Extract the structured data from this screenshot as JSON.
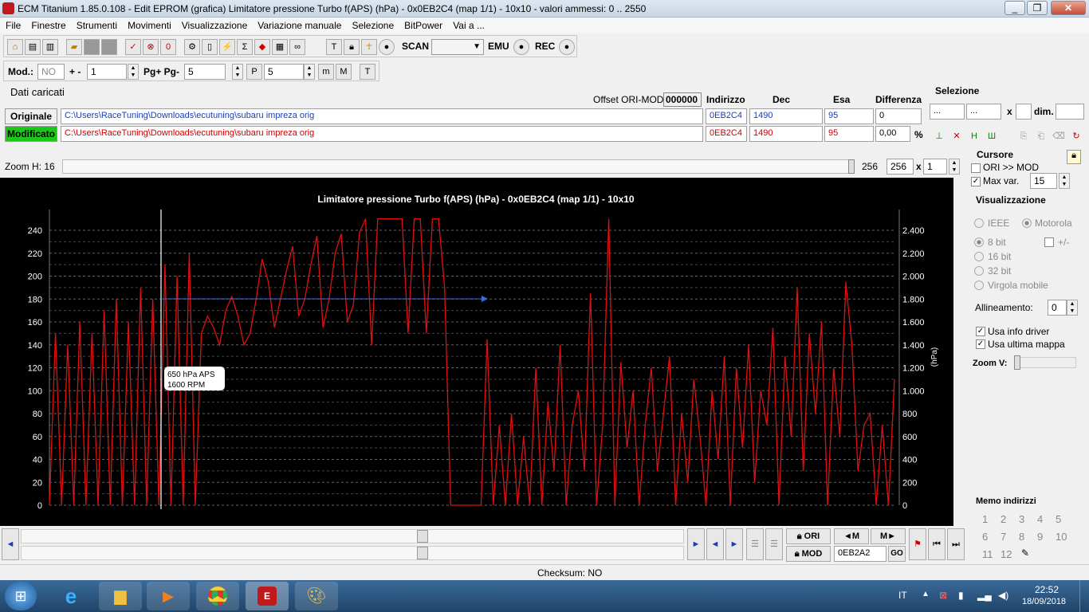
{
  "window": {
    "title": "ECM Titanium 1.85.0.108 - Edit EPROM (grafica) Limitatore pressione Turbo f(APS) (hPa) - 0x0EB2C4 (map 1/1) - 10x10 - valori ammessi: 0 .. 2550"
  },
  "menu": [
    "File",
    "Finestre",
    "Strumenti",
    "Movimenti",
    "Visualizzazione",
    "Variazione manuale",
    "Selezione",
    "BitPower",
    "Vai a ..."
  ],
  "toolbar": {
    "scan": "SCAN",
    "emu": "EMU",
    "rec": "REC"
  },
  "toolbar2": {
    "mod_label": "Mod.:",
    "mod_value": "NO",
    "plusminus": "+ -",
    "step_value": "1",
    "pg_label": "Pg+ Pg-",
    "pg_value": "5",
    "p_value": "5"
  },
  "data": {
    "header": "Dati caricati",
    "offset_label": "Offset ORI-MOD",
    "offset_value": "000000",
    "col_addr": "Indirizzo",
    "col_dec": "Dec",
    "col_hex": "Esa",
    "col_diff": "Differenza",
    "orig": {
      "label": "Originale",
      "path": "C:\\Users\\RaceTuning\\Downloads\\ecutuning\\subaru impreza orig",
      "addr": "0EB2C4",
      "dec": "1490",
      "hex": "95",
      "diff": "0"
    },
    "mod": {
      "label": "Modificato",
      "path": "C:\\Users\\RaceTuning\\Downloads\\ecutuning\\subaru impreza orig",
      "addr": "0EB2C4",
      "dec": "1490",
      "hex": "95",
      "diff": "0,00",
      "pct": "%"
    }
  },
  "selezione": {
    "title": "Selezione",
    "v1": "...",
    "v2": "...",
    "x": "x",
    "dim": "dim."
  },
  "zoom": {
    "label": "Zoom H: 16",
    "v1": "256",
    "v2": "256",
    "x": "x",
    "v3": "1"
  },
  "cursore": {
    "title": "Cursore",
    "ori_mod": "ORI >> MOD",
    "maxvar": "Max var.",
    "maxvar_value": "15"
  },
  "visual": {
    "title": "Visualizzazione",
    "ieee": "IEEE",
    "motorola": "Motorola",
    "b8": "8 bit",
    "pm": "+/-",
    "b16": "16 bit",
    "b32": "32 bit",
    "float": "Virgola mobile",
    "align_label": "Allineamento:",
    "align_value": "0",
    "driver": "Usa info driver",
    "lastmap": "Usa ultima mappa",
    "zoomv": "Zoom V:"
  },
  "memo": {
    "title": "Memo indirizzi",
    "nums": [
      "1",
      "2",
      "3",
      "4",
      "5",
      "6",
      "7",
      "8",
      "9",
      "10",
      "11",
      "12"
    ]
  },
  "bottom": {
    "ori": "ORI",
    "mod": "MOD",
    "addr": "0EB2A2",
    "go": "GO",
    "m1": "◄M",
    "m2": "M►"
  },
  "status": {
    "checksum": "Checksum: NO"
  },
  "tray": {
    "lang": "IT",
    "time": "22:52",
    "date": "18/09/2018"
  },
  "chart_data": {
    "type": "line",
    "title": "Limitatore pressione Turbo f(APS) (hPa) - 0x0EB2C4 (map 1/1) - 10x10",
    "ylabel_right": "(hPa)",
    "left_ticks": [
      "0",
      "20",
      "40",
      "60",
      "80",
      "100",
      "120",
      "140",
      "160",
      "180",
      "200",
      "220",
      "240"
    ],
    "right_ticks": [
      "0",
      "200",
      "400",
      "600",
      "800",
      "1.000",
      "1.200",
      "1.400",
      "1.600",
      "1.800",
      "2.000",
      "2.200",
      "2.400"
    ],
    "ylim": [
      0,
      2550
    ],
    "tooltip": [
      "650 hPa APS",
      "1600 RPM"
    ],
    "series_color": "#e01010",
    "values": [
      0,
      1500,
      0,
      1400,
      0,
      1600,
      0,
      1500,
      0,
      1700,
      0,
      1800,
      0,
      1600,
      0,
      1900,
      0,
      1800,
      0,
      2100,
      0,
      2000,
      0,
      2200,
      0,
      1500,
      1650,
      1550,
      1400,
      1700,
      1820,
      1650,
      1400,
      1500,
      1800,
      2150,
      1950,
      1550,
      1800,
      2050,
      2260,
      1650,
      1800,
      2100,
      2350,
      1550,
      1800,
      2200,
      2370,
      1600,
      1750,
      2380,
      2500,
      1400,
      2500,
      2500,
      2500,
      2500,
      2500,
      1500,
      2500,
      2500,
      1500,
      2500,
      2500,
      1900,
      0,
      0,
      0,
      0,
      0,
      0,
      1450,
      0,
      700,
      0,
      800,
      0,
      600,
      0,
      1200,
      0,
      900,
      300,
      1400,
      0,
      700,
      1000,
      300,
      1850,
      0,
      700,
      2500,
      0,
      1250,
      500,
      1000,
      0,
      700,
      1200,
      300,
      800,
      1300,
      0,
      800,
      200,
      1100,
      600,
      0,
      1000,
      400,
      1300,
      0,
      1200,
      500,
      1400,
      200,
      1000,
      700,
      1550,
      0,
      1300,
      600,
      1900,
      300,
      1500,
      800,
      1600,
      0,
      1200,
      600,
      1950,
      1400,
      300,
      700,
      800,
      0,
      700,
      0,
      1100
    ]
  }
}
